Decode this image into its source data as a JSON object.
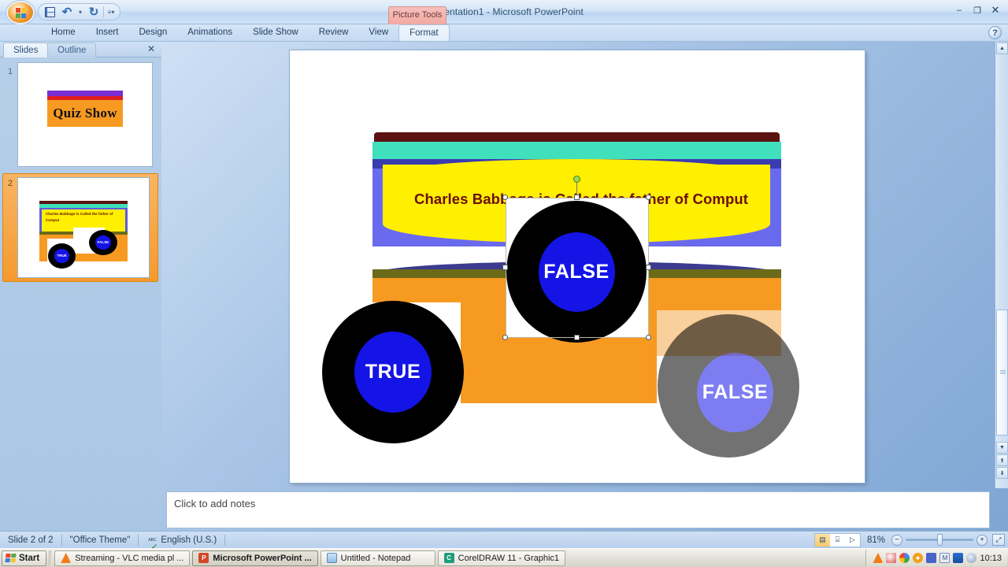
{
  "window": {
    "title": "Presentation1  -  Microsoft PowerPoint",
    "contextual_tab": "Picture Tools",
    "minimize": "–",
    "restore": "❐",
    "close": "✕",
    "help": "?"
  },
  "quick_access": {
    "save": "save-icon",
    "undo": "↶",
    "undo_caret": "▾",
    "redo": "↻",
    "customize_caret": "≡▾"
  },
  "ribbon": {
    "tabs": [
      {
        "label": "Home",
        "active": false
      },
      {
        "label": "Insert",
        "active": false
      },
      {
        "label": "Design",
        "active": false
      },
      {
        "label": "Animations",
        "active": false
      },
      {
        "label": "Slide Show",
        "active": false
      },
      {
        "label": "Review",
        "active": false
      },
      {
        "label": "View",
        "active": false
      },
      {
        "label": "Format",
        "active": true
      }
    ]
  },
  "sidebar": {
    "tabs": [
      {
        "label": "Slides",
        "active": true
      },
      {
        "label": "Outline",
        "active": false
      }
    ],
    "close_label": "✕",
    "thumbnails": [
      {
        "number": "1",
        "selected": false,
        "title": "Quiz Show"
      },
      {
        "number": "2",
        "selected": true,
        "text": "Charles Babbage is Called the father of Comput",
        "true_label": "TRUE",
        "false_label": "FALSE"
      }
    ]
  },
  "slide": {
    "text": "Charles Babbage is Called the father of Comput",
    "buttons": {
      "true_label": "TRUE",
      "false_label": "FALSE",
      "false_ghost_label": "FALSE"
    },
    "colors": {
      "maroon": "#5b1210",
      "turquoise": "#40e0bc",
      "indigo": "#3b3bb0",
      "periwinkle": "#6a6aee",
      "yellow": "#ffef00",
      "olive": "#6b6a18",
      "orange": "#f79a22",
      "tan": "#f9cf9b",
      "button_black": "#000000",
      "button_blue": "#1414e6",
      "text_maroon": "#6b0d0d"
    }
  },
  "notes": {
    "placeholder": "Click to add notes"
  },
  "scrollbar": {
    "up": "▲",
    "down": "▼",
    "prev_slide": "⬆",
    "next_slide": "⬇"
  },
  "statusbar": {
    "slide_counter": "Slide 2 of 2",
    "theme": "\"Office Theme\"",
    "spellcheck_icon": "spellcheck-icon",
    "language": "English (U.S.)",
    "view_buttons": [
      {
        "name": "normal-view",
        "glyph": "▤",
        "active": true
      },
      {
        "name": "slide-sorter-view",
        "glyph": "⌸",
        "active": false
      },
      {
        "name": "slide-show-view",
        "glyph": "▷",
        "active": false
      }
    ],
    "zoom_level": "81%",
    "zoom_out": "−",
    "zoom_in": "+",
    "fit_to_window": "⤢"
  },
  "taskbar": {
    "start_label": "Start",
    "items": [
      {
        "label": "Streaming - VLC media pl ...",
        "icon": "vlc-icon",
        "active": false
      },
      {
        "label": "Microsoft PowerPoint ...",
        "icon": "powerpoint-icon",
        "active": true
      },
      {
        "label": "Untitled - Notepad",
        "icon": "notepad-icon",
        "active": false
      },
      {
        "label": "CorelDRAW 11 - Graphic1",
        "icon": "coreldraw-icon",
        "active": false
      }
    ],
    "clock": "10:13"
  }
}
